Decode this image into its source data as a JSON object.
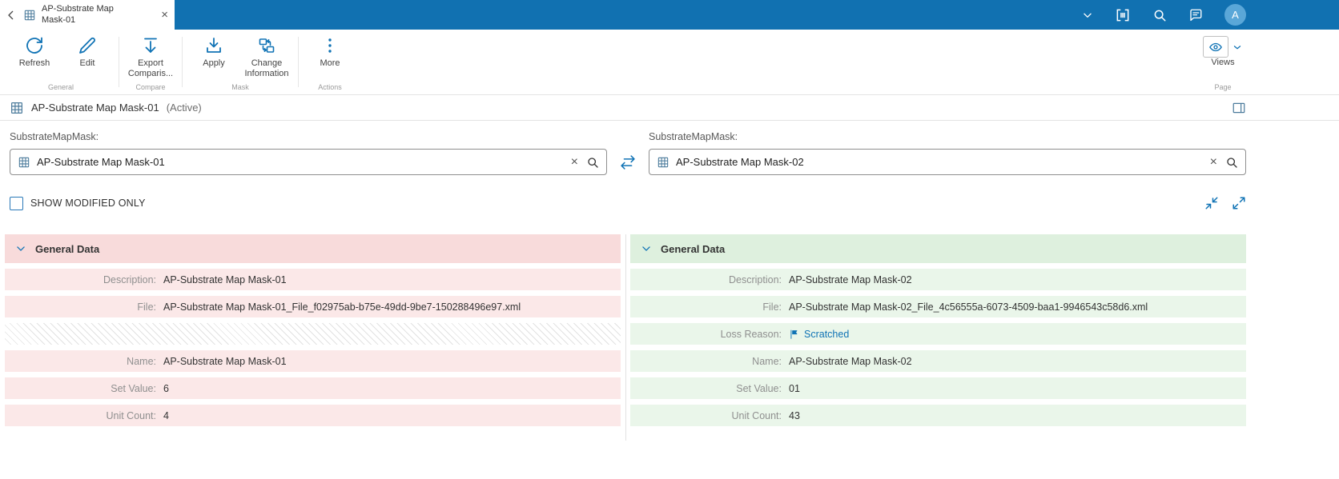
{
  "colors": {
    "topbar": "#1171b1",
    "accent": "#1073b5",
    "left_header_bg": "#f8dbdb",
    "left_row_bg": "#fbe8e8",
    "right_header_bg": "#def0de",
    "right_row_bg": "#eaf6ea"
  },
  "topbar": {
    "tab": {
      "title": "AP-Substrate Map Mask-01"
    },
    "avatar_initial": "A",
    "icons": [
      "chevron-down-icon",
      "scanner-icon",
      "search-icon",
      "feedback-icon",
      "avatar"
    ]
  },
  "ribbon": {
    "groups": [
      {
        "label": "General",
        "buttons": [
          {
            "label": "Refresh",
            "icon": "refresh-icon"
          },
          {
            "label": "Edit",
            "icon": "edit-icon"
          }
        ]
      },
      {
        "label": "Compare",
        "buttons": [
          {
            "label": "Export Comparis...",
            "icon": "export-icon"
          }
        ]
      },
      {
        "label": "Mask",
        "buttons": [
          {
            "label": "Apply",
            "icon": "apply-icon"
          },
          {
            "label": "Change Information",
            "icon": "change-information-icon"
          }
        ]
      },
      {
        "label": "Actions",
        "buttons": [
          {
            "label": "More",
            "icon": "more-icon"
          }
        ]
      }
    ],
    "views": {
      "label": "Views",
      "group_label": "Page",
      "icon": "eye-icon"
    }
  },
  "entity_header": {
    "title": "AP-Substrate Map Mask-01",
    "status": "(Active)"
  },
  "compare": {
    "left": {
      "field_label": "SubstrateMapMask:",
      "value": "AP-Substrate Map Mask-01"
    },
    "right": {
      "field_label": "SubstrateMapMask:",
      "value": "AP-Substrate Map Mask-02"
    },
    "show_modified_label": "SHOW MODIFIED ONLY",
    "show_modified_checked": false
  },
  "left_panel": {
    "section_title": "General Data",
    "rows": {
      "description": {
        "label": "Description:",
        "value": "AP-Substrate Map Mask-01"
      },
      "file": {
        "label": "File:",
        "value": "AP-Substrate Map Mask-01_File_f02975ab-b75e-49dd-9be7-150288496e97.xml"
      },
      "name": {
        "label": "Name:",
        "value": "AP-Substrate Map Mask-01"
      },
      "set_value": {
        "label": "Set Value:",
        "value": "6"
      },
      "unit_count": {
        "label": "Unit Count:",
        "value": "4"
      }
    }
  },
  "right_panel": {
    "section_title": "General Data",
    "rows": {
      "description": {
        "label": "Description:",
        "value": "AP-Substrate Map Mask-02"
      },
      "file": {
        "label": "File:",
        "value": "AP-Substrate Map Mask-02_File_4c56555a-6073-4509-baa1-9946543c58d6.xml"
      },
      "loss_reason": {
        "label": "Loss Reason:",
        "value": "Scratched"
      },
      "name": {
        "label": "Name:",
        "value": "AP-Substrate Map Mask-02"
      },
      "set_value": {
        "label": "Set Value:",
        "value": "01"
      },
      "unit_count": {
        "label": "Unit Count:",
        "value": "43"
      }
    }
  }
}
